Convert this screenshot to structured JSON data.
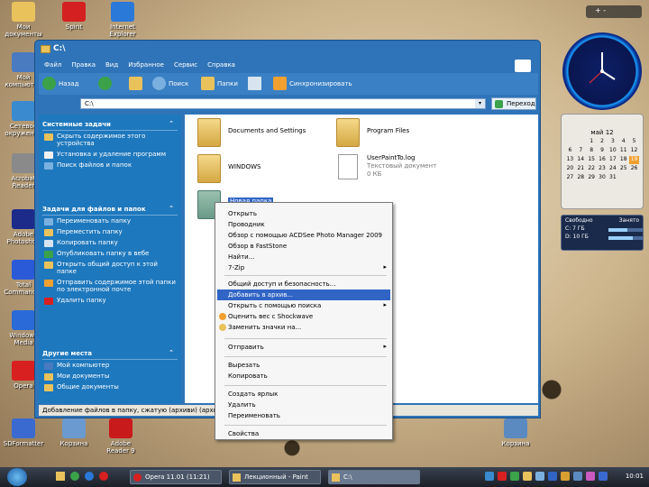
{
  "desktop": {
    "icons": [
      {
        "label": "Мои документы",
        "color": "#e9c25c"
      },
      {
        "label": "Spirit",
        "color": "#d42020"
      },
      {
        "label": "Internet Explorer",
        "color": "#2a78d8"
      },
      {
        "label": "Мой компьютер",
        "color": "#4a7ac0"
      },
      {
        "label": "Сетевое окружение",
        "color": "#3a8ad0"
      },
      {
        "label": "Acrobat Reader",
        "color": "#8a8a8a"
      },
      {
        "label": "Adobe Photoshop",
        "color": "#1c2a8a"
      },
      {
        "label": "Total Commander",
        "color": "#2a5ad8"
      },
      {
        "label": "Windows Media",
        "color": "#2a6ad8"
      },
      {
        "label": "Opera",
        "color": "#d82020"
      },
      {
        "label": "SDFormatter",
        "color": "#3a6ad0"
      },
      {
        "label": "Корзина",
        "color": "#5a8ac0"
      },
      {
        "label": "Adobe Reader 9",
        "color": "#c81a1a"
      },
      {
        "label": "Корзина",
        "color": "#6a9ad0"
      }
    ]
  },
  "window": {
    "title": "C:\\",
    "menu": [
      "Файл",
      "Правка",
      "Вид",
      "Избранное",
      "Сервис",
      "Справка"
    ],
    "toolbar": {
      "back_label": "Назад",
      "search_label": "Поиск",
      "folders_label": "Папки",
      "synchronize_label": "Синхронизировать"
    },
    "address": {
      "value": "C:\\",
      "go_label": "Переход"
    },
    "left_pane": {
      "system_tasks": {
        "title": "Системные задачи",
        "items": [
          "Скрыть содержимое этого устройства",
          "Установка и удаление программ",
          "Поиск файлов и папок"
        ]
      },
      "file_tasks": {
        "title": "Задачи для файлов и папок",
        "items": [
          "Переименовать папку",
          "Переместить папку",
          "Копировать папку",
          "Опубликовать папку в вебе",
          "Открыть общий доступ к этой папке",
          "Отправить содержимое этой папки по электронной почте",
          "Удалить папку"
        ]
      },
      "other_places": {
        "title": "Другие места",
        "items": [
          "Мой компьютер",
          "Мои документы",
          "Общие документы"
        ]
      }
    },
    "files": [
      {
        "name": "Documents and Settings"
      },
      {
        "name": "Program Files"
      },
      {
        "name": "WINDOWS"
      },
      {
        "name": "UserPaintTo.log",
        "type": "Текстовый документ",
        "size": "0 КБ"
      },
      {
        "name": "Новая папка"
      }
    ],
    "status": "Добавление файлов в папку, сжатую (архиви) (архив) и... можно изменить для этого"
  },
  "context_menu": {
    "items": [
      {
        "label": "Открыть"
      },
      {
        "label": "Проводник"
      },
      {
        "label": "Обзор с помощью ACDSee Photo Manager 2009"
      },
      {
        "label": "Обзор в FastStone"
      },
      {
        "label": "Найти..."
      },
      {
        "label": "7-Zip",
        "submenu": true
      },
      {
        "label": "Общий доступ и безопасность..."
      },
      {
        "label": "Добавить в архив...",
        "selected": true
      },
      {
        "label": "Открыть с помощью поиска",
        "submenu": true
      },
      {
        "label": "Оценить вес с Shockwave"
      },
      {
        "label": "Заменить значки на..."
      },
      {
        "label": "Отправить",
        "submenu": true
      },
      {
        "label": "Вырезать"
      },
      {
        "label": "Копировать"
      },
      {
        "label": "Создать ярлык"
      },
      {
        "label": "Удалить"
      },
      {
        "label": "Переименовать"
      },
      {
        "label": "Свойства"
      }
    ]
  },
  "gadgets": {
    "calendar": {
      "month_label": "май 12",
      "days": [
        "",
        "",
        "1",
        "2",
        "3",
        "4",
        "5",
        "6",
        "7",
        "8",
        "9",
        "10",
        "11",
        "12",
        "13",
        "14",
        "15",
        "16",
        "17",
        "18",
        "19",
        "20",
        "21",
        "22",
        "23",
        "24",
        "25",
        "26",
        "27",
        "28",
        "29",
        "30",
        "31",
        "",
        ""
      ],
      "today": "19"
    },
    "drives": {
      "header_free": "Свободно",
      "header_used": "Занято",
      "rows": [
        {
          "label": "C: 7 ГБ",
          "used_fraction": 0.55
        },
        {
          "label": "D: 10 ГБ",
          "used_fraction": 0.7
        }
      ]
    },
    "topbar": "+ -"
  },
  "taskbar": {
    "buttons": [
      "Opera 11.01 (11:21)",
      "Лекционный - Paint",
      "C:\\"
    ],
    "clock": "10:01"
  }
}
